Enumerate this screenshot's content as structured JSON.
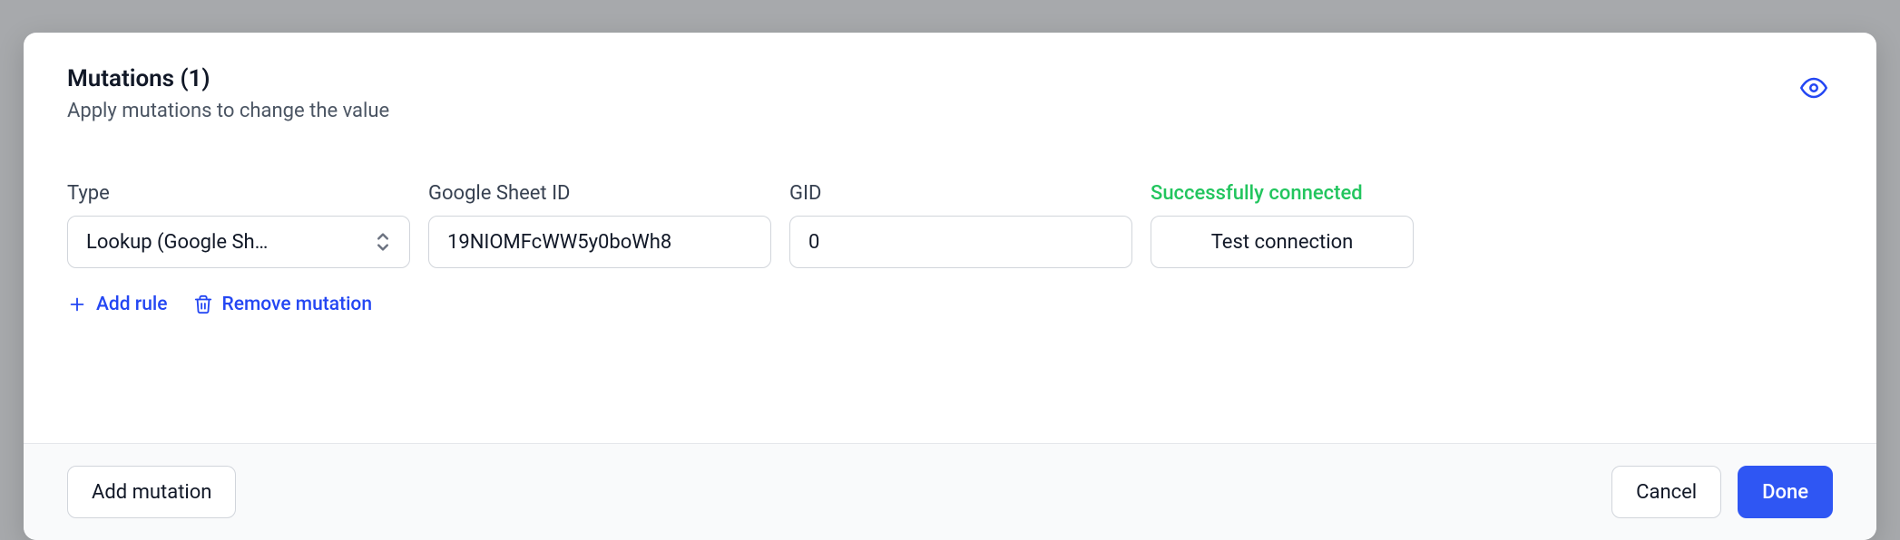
{
  "header": {
    "title": "Mutations (1)",
    "subtitle": "Apply mutations to change the value"
  },
  "fields": {
    "type": {
      "label": "Type",
      "value": "Lookup (Google Sh…"
    },
    "sheet": {
      "label": "Google Sheet ID",
      "value": "19NIOMFcWW5y0boWh8"
    },
    "gid": {
      "label": "GID",
      "value": "0"
    },
    "status": {
      "label": "Successfully connected",
      "test_button": "Test connection"
    }
  },
  "links": {
    "add_rule": "Add rule",
    "remove_mutation": "Remove mutation"
  },
  "footer": {
    "add_mutation": "Add mutation",
    "cancel": "Cancel",
    "done": "Done"
  }
}
